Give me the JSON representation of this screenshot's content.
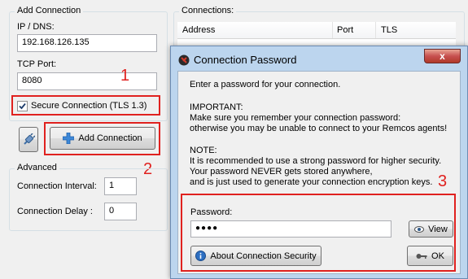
{
  "left_panel": {
    "group_title": "Add Connection",
    "ip_label": "IP / DNS:",
    "ip_value": "192.168.126.135",
    "port_label": "TCP Port:",
    "port_value": "8080",
    "tls_checkbox_label": "Secure Connection (TLS 1.3)",
    "add_button_label": "Add Connection",
    "advanced_title": "Advanced",
    "interval_label": "Connection Interval:",
    "interval_value": "1",
    "delay_label": "Connection Delay :",
    "delay_value": "0"
  },
  "connections": {
    "title": "Connections:",
    "columns": [
      "Address",
      "Port",
      "TLS"
    ]
  },
  "dialog": {
    "title": "Connection Password",
    "close_glyph": "x",
    "intro": "Enter a password for your connection.",
    "important_heading": "IMPORTANT:",
    "important_line1": "Make sure you remember your connection password:",
    "important_line2": "otherwise you may be unable to connect to your Remcos agents!",
    "note_heading": "NOTE:",
    "note_line1": "It is recommended to use a strong password for higher security.",
    "note_line2": "Your password NEVER gets stored anywhere,",
    "note_line3": "and is just used to generate your connection encryption keys.",
    "password_label": "Password:",
    "password_value": "●●●●",
    "view_button": "View",
    "about_button": "About Connection Security",
    "ok_button": "OK"
  },
  "annotations": [
    "1",
    "2",
    "3"
  ],
  "colors": {
    "annotation_red": "#e0211f",
    "dialog_frame": "#bcd5ee"
  }
}
